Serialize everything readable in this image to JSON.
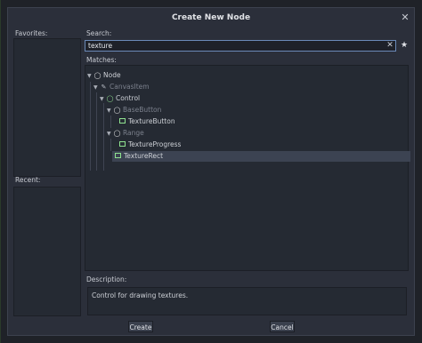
{
  "dialog": {
    "title": "Create New Node",
    "close_icon": "close-icon"
  },
  "favorites": {
    "label": "Favorites:"
  },
  "recent": {
    "label": "Recent:"
  },
  "search": {
    "label": "Search:",
    "value": "texture"
  },
  "matches": {
    "label": "Matches:",
    "items": [
      {
        "name": "Node"
      },
      {
        "name": "CanvasItem"
      },
      {
        "name": "Control"
      },
      {
        "name": "BaseButton"
      },
      {
        "name": "TextureButton"
      },
      {
        "name": "Range"
      },
      {
        "name": "TextureProgress"
      },
      {
        "name": "TextureRect"
      }
    ]
  },
  "description": {
    "label": "Description:",
    "text": "Control for drawing textures."
  },
  "buttons": {
    "create": "Create",
    "cancel": "Cancel"
  }
}
